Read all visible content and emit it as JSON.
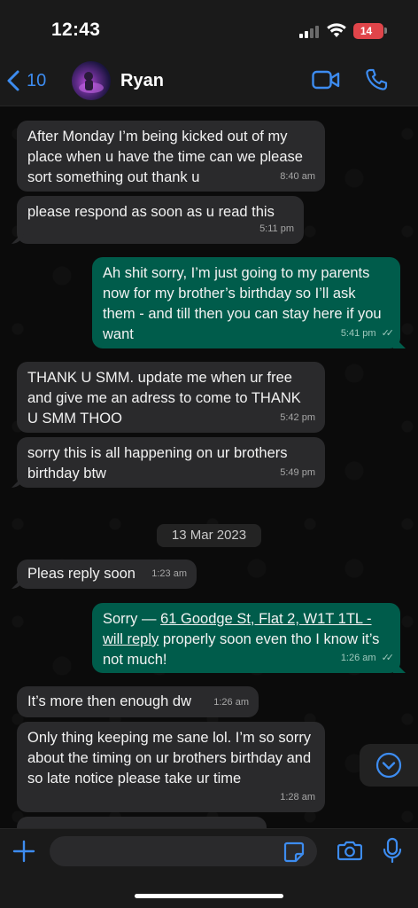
{
  "status_bar": {
    "time": "12:43",
    "battery": "14"
  },
  "header": {
    "back_count": "10",
    "contact_name": "Ryan"
  },
  "messages": [
    {
      "dir": "in",
      "text": "After Monday I’m being kicked out of my place when u have the time can we please sort something out thank u",
      "time": "8:40 am"
    },
    {
      "dir": "in",
      "text": "please respond as soon as u read this",
      "time": "5:11 pm"
    },
    {
      "dir": "out",
      "text": "Ah shit sorry, I’m just going to my parents now for my brother’s birthday so I’ll ask them - and till then you can stay here if you want",
      "time": "5:41 pm"
    },
    {
      "dir": "in",
      "text": "THANK U SMM. update me when ur free and give me an adress to come to THANK U SMM THOO",
      "time": "5:42 pm"
    },
    {
      "dir": "in",
      "text": "sorry this is all happening on ur brothers birthday btw",
      "time": "5:49 pm"
    },
    {
      "dir": "in",
      "text": "Pleas reply soon",
      "time": "1:23 am"
    },
    {
      "dir": "out",
      "text_prefix": "Sorry — ",
      "link_text": "61 Goodge St, Flat 2, W1T 1TL - will reply",
      "text_suffix": " properly soon even tho I know it’s not much!",
      "time": "1:26 am"
    },
    {
      "dir": "in",
      "text": "It’s more then enough dw",
      "time": "1:26 am"
    },
    {
      "dir": "in",
      "text": "Only thing keeping me sane lol. I’m so sorry about the timing on ur brothers birthday and so late notice please take ur time",
      "time": "1:28 am"
    }
  ],
  "date_separator": "13 Mar 2023",
  "input": {
    "placeholder": ""
  },
  "colors": {
    "accent": "#3d8cf0",
    "outgoing": "#005c4b",
    "incoming": "#2a2a2c",
    "battery": "#e0454a"
  }
}
